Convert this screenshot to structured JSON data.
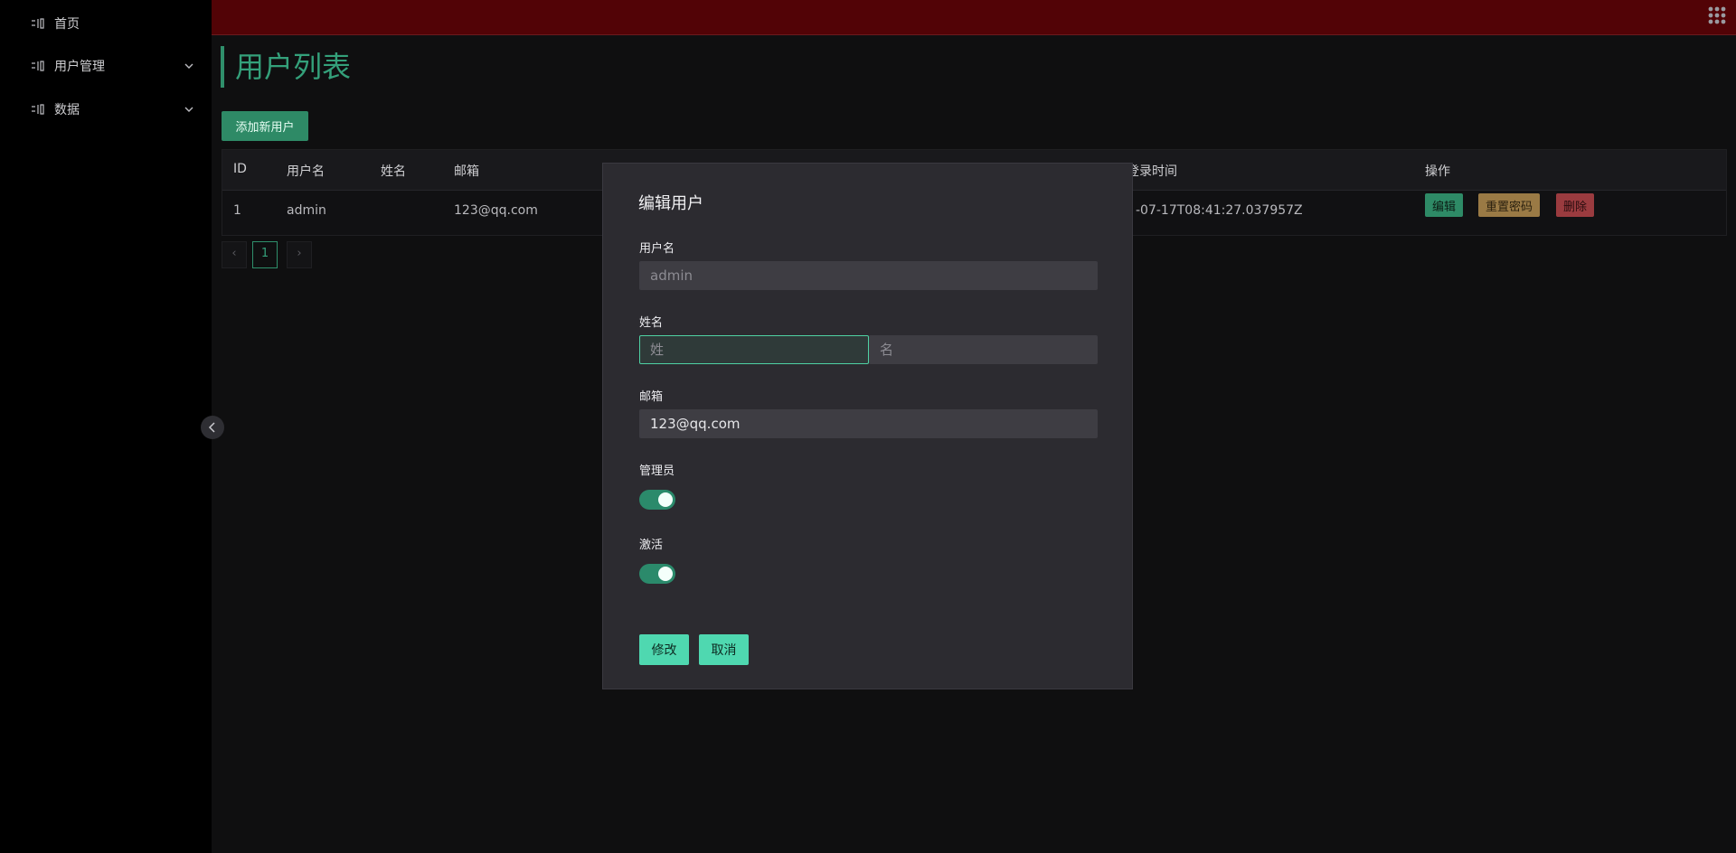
{
  "sidebar": {
    "items": [
      {
        "label": "首页",
        "icon": "panel-icon",
        "has_children": false
      },
      {
        "label": "用户管理",
        "icon": "panel-icon",
        "has_children": true
      },
      {
        "label": "数据",
        "icon": "panel-icon",
        "has_children": true
      }
    ]
  },
  "topbar": {
    "apps_icon": "grid-icon"
  },
  "page": {
    "title": "用户列表",
    "add_button": "添加新用户"
  },
  "table": {
    "headers": [
      "ID",
      "用户名",
      "姓名",
      "邮箱",
      "登录时间",
      "操作"
    ],
    "rows": [
      {
        "id": "1",
        "username": "admin",
        "name": "",
        "email": "123@qq.com",
        "login_time": "-07-17T08:41:27.037957Z"
      }
    ],
    "actions": {
      "edit": "编辑",
      "reset": "重置密码",
      "delete": "删除"
    }
  },
  "pagination": {
    "prev": "‹",
    "current": "1",
    "next": "›"
  },
  "modal": {
    "title": "编辑用户",
    "username_label": "用户名",
    "username_value": "admin",
    "name_label": "姓名",
    "last_name_placeholder": "姓",
    "first_name_placeholder": "名",
    "email_label": "邮箱",
    "email_value": "123@qq.com",
    "admin_label": "管理员",
    "admin_on": true,
    "active_label": "激活",
    "active_on": true,
    "submit": "修改",
    "cancel": "取消"
  },
  "colors": {
    "accent": "#2e8a66",
    "topbar": "#520306",
    "modal_button": "#4fd8b0",
    "warning": "#9a7a45",
    "danger": "#9a3b3f"
  }
}
